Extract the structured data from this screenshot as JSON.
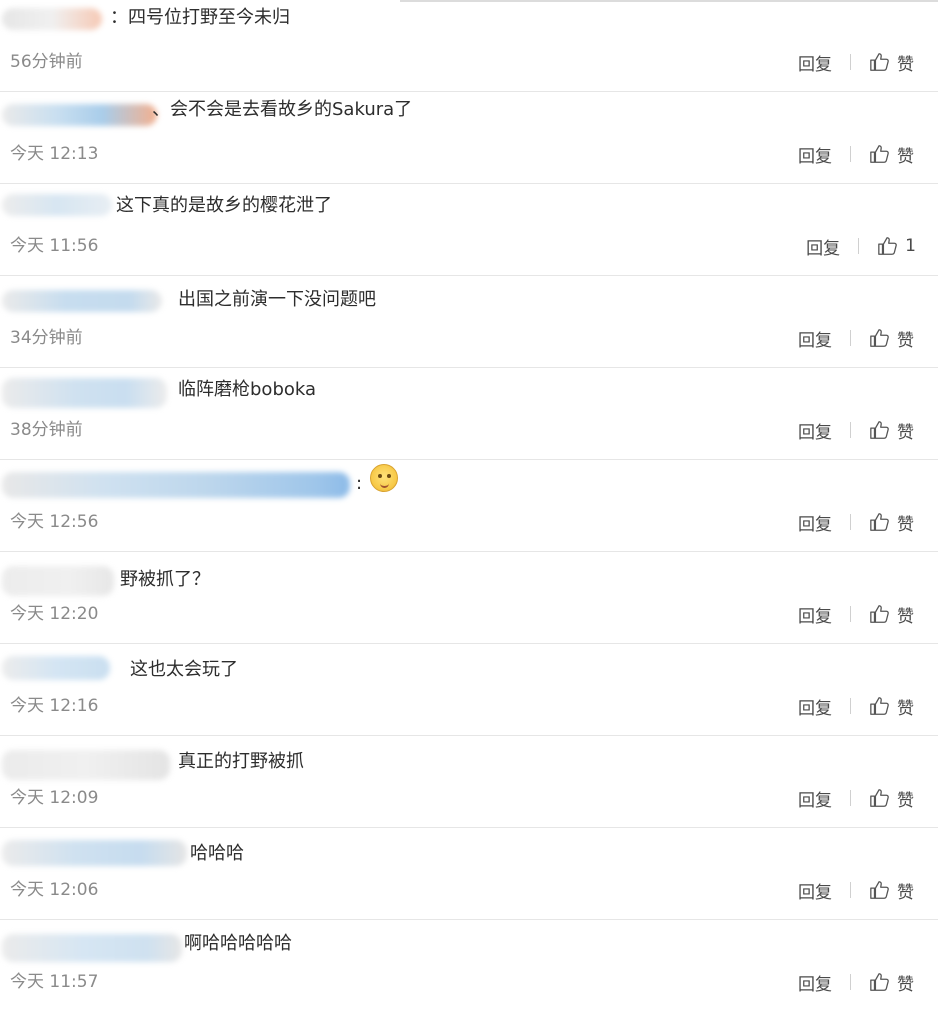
{
  "actions": {
    "reply_label": "回复",
    "like_label": "赞"
  },
  "colors": {
    "text": "#2d2d2d",
    "time": "#8a8a8a",
    "divider": "#e6e6e6",
    "blur_blue": "#a9cdea",
    "blur_orange": "#f3b08f"
  },
  "icons": {
    "like": "thumbs-up-icon",
    "emoji": "smiling-face-emoji-icon"
  },
  "comments": [
    {
      "text": "：四号位打野至今未归",
      "time": "56分钟前",
      "like_label": "赞"
    },
    {
      "text": "、会不会是去看故乡的Sakura了",
      "time": "今天 12:13",
      "like_label": "赞"
    },
    {
      "text": "这下真的是故乡的樱花泄了",
      "time": "今天 11:56",
      "like_label": "1"
    },
    {
      "text": "出国之前演一下没问题吧",
      "time": "34分钟前",
      "like_label": "赞"
    },
    {
      "text": "临阵磨枪boboka",
      "time": "38分钟前",
      "like_label": "赞"
    },
    {
      "text": ":",
      "time": "今天 12:56",
      "like_label": "赞"
    },
    {
      "text": "野被抓了？",
      "time": "今天 12:20",
      "like_label": "赞"
    },
    {
      "text": "这也太会玩了",
      "time": "今天 12:16",
      "like_label": "赞"
    },
    {
      "text": "真正的打野被抓",
      "time": "今天 12:09",
      "like_label": "赞"
    },
    {
      "text": "哈哈哈",
      "time": "今天 12:06",
      "like_label": "赞"
    },
    {
      "text": "啊哈哈哈哈哈",
      "time": "今天 11:57",
      "like_label": "赞"
    }
  ]
}
